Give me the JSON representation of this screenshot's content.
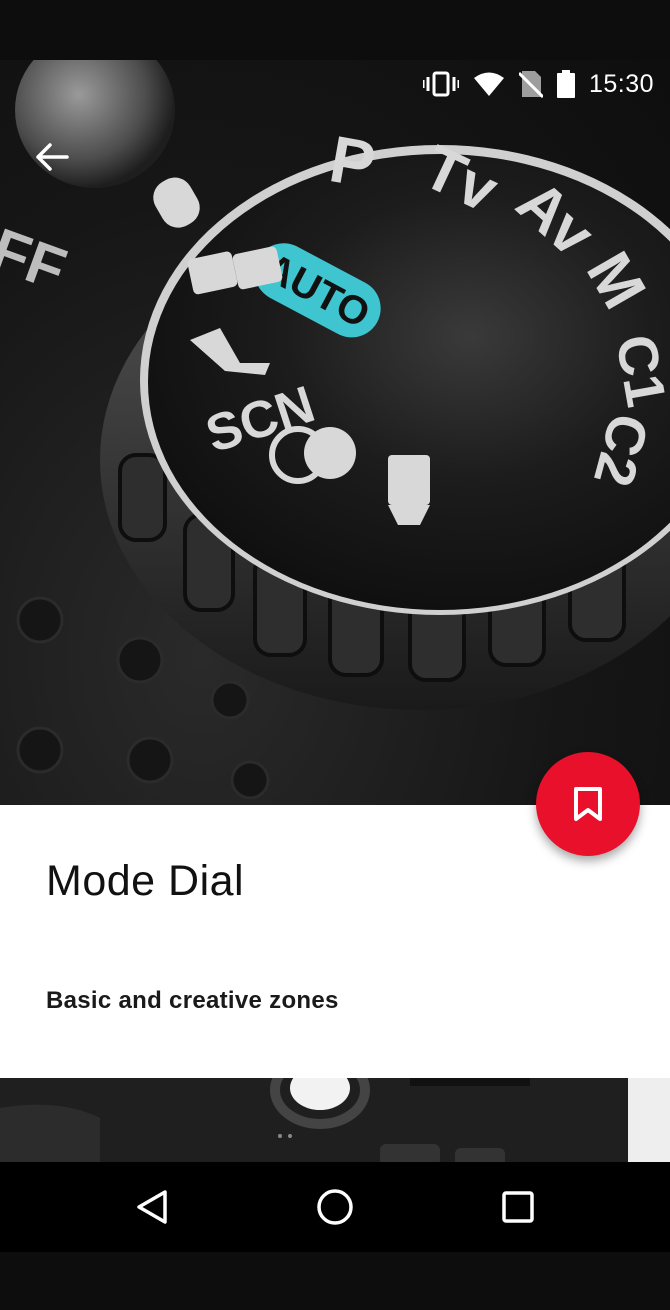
{
  "status_bar": {
    "time": "15:30",
    "icons": [
      "vibrate-icon",
      "wifi-icon",
      "no-sim-icon",
      "battery-icon"
    ]
  },
  "hero": {
    "dial_labels": [
      "AUTO",
      "P",
      "Tv",
      "Av",
      "M",
      "C1",
      "C2",
      "SCN"
    ],
    "accent_color": "#3ec5cf"
  },
  "content": {
    "title": "Mode Dial",
    "subtitle": "Basic and creative zones"
  },
  "fab": {
    "icon": "bookmark-icon",
    "color": "#e8102a"
  },
  "nav": {
    "icons": [
      "back-triangle-icon",
      "home-circle-icon",
      "recents-square-icon"
    ]
  }
}
